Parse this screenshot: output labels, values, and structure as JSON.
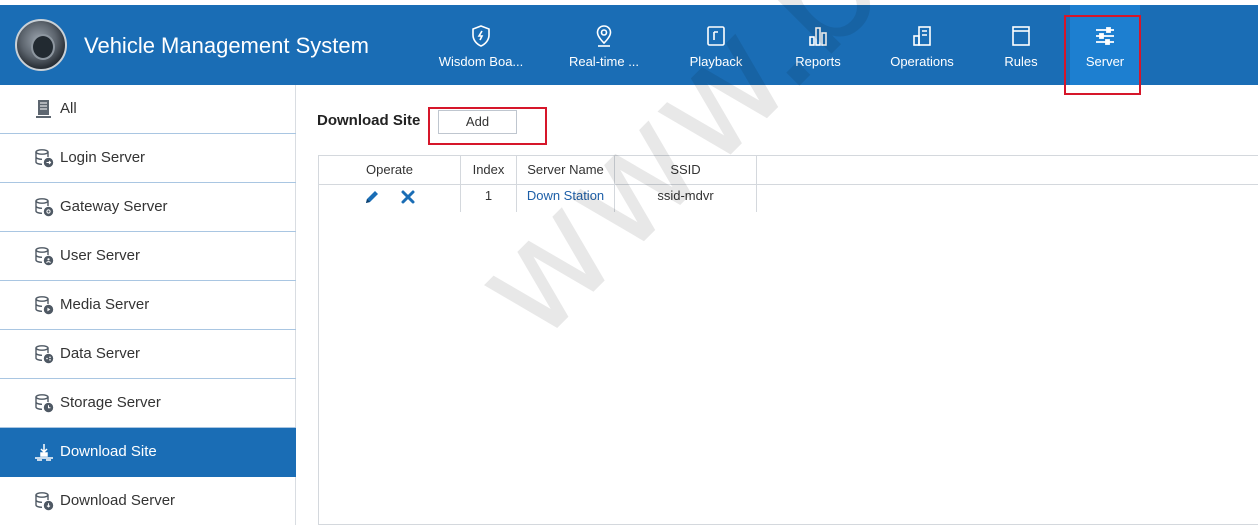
{
  "app": {
    "title": "Vehicle Management System"
  },
  "nav": [
    {
      "label": "Wisdom Boa...",
      "icon": "shield-icon"
    },
    {
      "label": "Real-time ...",
      "icon": "location-pin-icon"
    },
    {
      "label": "Playback",
      "icon": "playback-icon"
    },
    {
      "label": "Reports",
      "icon": "bar-chart-icon"
    },
    {
      "label": "Operations",
      "icon": "operations-icon"
    },
    {
      "label": "Rules",
      "icon": "rules-icon"
    },
    {
      "label": "Server",
      "icon": "sliders-icon",
      "active": true
    }
  ],
  "sidebar": [
    {
      "label": "All",
      "icon": "server-rack-icon"
    },
    {
      "label": "Login Server",
      "icon": "database-login-icon"
    },
    {
      "label": "Gateway Server",
      "icon": "database-gateway-icon"
    },
    {
      "label": "User Server",
      "icon": "database-user-icon"
    },
    {
      "label": "Media Server",
      "icon": "database-media-icon"
    },
    {
      "label": "Data Server",
      "icon": "database-data-icon"
    },
    {
      "label": "Storage Server",
      "icon": "database-storage-icon"
    },
    {
      "label": "Download Site",
      "icon": "download-site-icon",
      "active": true
    },
    {
      "label": "Download Server",
      "icon": "database-download-icon"
    }
  ],
  "main": {
    "title": "Download Site",
    "add_label": "Add",
    "columns": [
      "Operate",
      "Index",
      "Server Name",
      "SSID"
    ],
    "rows": [
      {
        "index": "1",
        "server_name": "Down Station",
        "ssid": "ssid-mdvr"
      }
    ]
  },
  "watermark": "www.bez",
  "colors": {
    "primary": "#1a6db5",
    "active_nav": "#1d7fd0",
    "highlight": "#d6162a",
    "link": "#1d5fa8"
  }
}
